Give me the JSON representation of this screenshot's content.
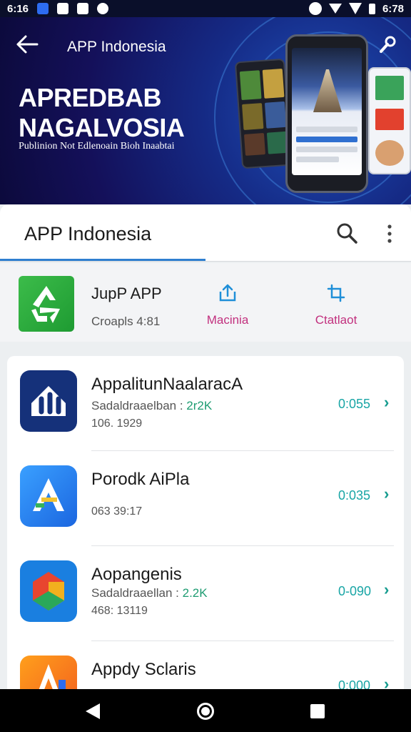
{
  "status_bar": {
    "time": "6:16",
    "right_time": "6:78"
  },
  "hero": {
    "title": "APP Indonesia",
    "headline_line1": "APREDBAB",
    "headline_line2": "NAGALVOSIA",
    "subtitle": "Publinion Not Edlenoain Bioh Inaabtai"
  },
  "topbar": {
    "title": "APP Indonesia"
  },
  "featured": {
    "name": "JupP APP",
    "meta": "Croapls 4:81",
    "action1_label": "Macinia",
    "action2_label": "Ctatlaot",
    "accent": "#c2307e"
  },
  "apps": [
    {
      "name": "AppalitunNaalaracA",
      "sub_label": "Sadaldraaelban :",
      "sub_value": "2r2K",
      "date": "106. 1929",
      "value": "0:055"
    },
    {
      "name": "Porodk AiPla",
      "date": "063 39:17",
      "value": "0:035"
    },
    {
      "name": "Aopangenis",
      "sub_label": "Sadaldraaellan :",
      "sub_value": "2.2K",
      "date": "468: 13119",
      "value": "0-090"
    },
    {
      "name": "Appdy Sclaris",
      "value": "0:000"
    }
  ],
  "colors": {
    "value_teal": "#18a5a5",
    "sub_green": "#1e9c72",
    "tab_blue": "#2f7fd0"
  }
}
